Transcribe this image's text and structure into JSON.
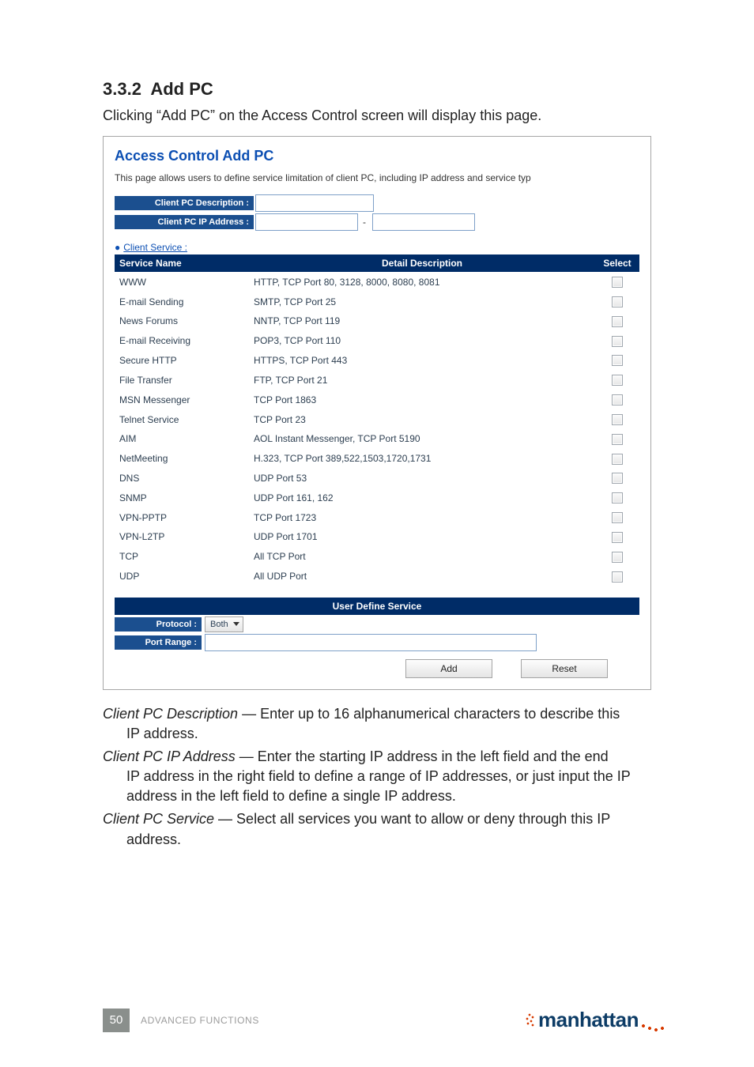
{
  "section": {
    "number": "3.3.2",
    "title": "Add PC"
  },
  "lead": "Clicking “Add PC” on the Access Control screen will display this page.",
  "panel": {
    "title": "Access Control Add PC",
    "desc": "This page allows users to define service limitation of client PC, including IP address and service typ",
    "desc_label": "Client PC Description :",
    "ip_label": "Client PC IP Address :",
    "ip_sep": "-",
    "service_heading": "Client Service :",
    "columns": {
      "name": "Service Name",
      "detail": "Detail Description",
      "select": "Select"
    },
    "services": [
      {
        "name": "WWW",
        "detail": "HTTP, TCP Port 80, 3128, 8000, 8080, 8081"
      },
      {
        "name": "E-mail Sending",
        "detail": "SMTP, TCP Port 25"
      },
      {
        "name": "News Forums",
        "detail": "NNTP, TCP Port 119"
      },
      {
        "name": "E-mail Receiving",
        "detail": "POP3, TCP Port 110"
      },
      {
        "name": "Secure HTTP",
        "detail": "HTTPS, TCP Port 443"
      },
      {
        "name": "File Transfer",
        "detail": "FTP, TCP Port 21"
      },
      {
        "name": "MSN Messenger",
        "detail": "TCP Port 1863"
      },
      {
        "name": "Telnet Service",
        "detail": "TCP Port 23"
      },
      {
        "name": "AIM",
        "detail": "AOL Instant Messenger, TCP Port 5190"
      },
      {
        "name": "NetMeeting",
        "detail": "H.323, TCP Port 389,522,1503,1720,1731"
      },
      {
        "name": "DNS",
        "detail": "UDP Port 53"
      },
      {
        "name": "SNMP",
        "detail": "UDP Port 161, 162"
      },
      {
        "name": "VPN-PPTP",
        "detail": "TCP Port 1723"
      },
      {
        "name": "VPN-L2TP",
        "detail": "UDP Port 1701"
      },
      {
        "name": "TCP",
        "detail": "All TCP Port"
      },
      {
        "name": "UDP",
        "detail": "All UDP Port"
      }
    ],
    "uds": {
      "heading": "User Define Service",
      "protocol_label": "Protocol :",
      "protocol_value": "Both",
      "port_label": "Port Range :",
      "add": "Add",
      "reset": "Reset"
    }
  },
  "explain": {
    "p1_term": "Client PC Description",
    "p1_rest": " — Enter up to 16 alphanumerical characters to describe this",
    "p1_cont": "IP address.",
    "p2_term": "Client PC IP Address",
    "p2_rest": " — Enter the starting IP address in the left field and the end",
    "p2_cont1": "IP address in the right field to define a range of IP addresses, or just input the IP",
    "p2_cont2": "address in the left field to define a single IP address.",
    "p3_term": "Client PC Service",
    "p3_rest": " — Select all services you want to allow or deny through this IP",
    "p3_cont": "address."
  },
  "footer": {
    "page": "50",
    "section": "ADVANCED FUNCTIONS",
    "brand": "manhattan"
  }
}
